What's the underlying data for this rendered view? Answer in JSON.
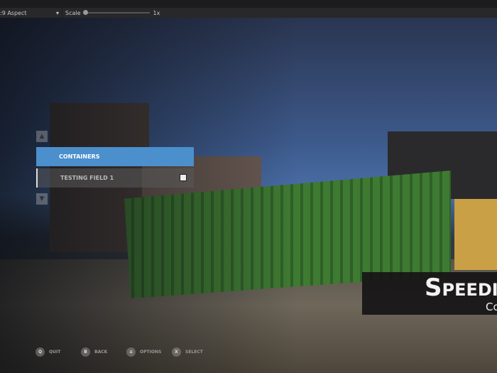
{
  "toolbar": {
    "aspect": ":9 Aspect",
    "scale_label": "Scale",
    "scale_value": "1x"
  },
  "menu": {
    "items": [
      {
        "label": "CONTAINERS",
        "selected": true
      },
      {
        "label": "TESTING FIELD 1",
        "selected": false
      }
    ]
  },
  "footer": [
    {
      "icon": "Q",
      "label": "QUIT"
    },
    {
      "icon": "B",
      "label": "BACK"
    },
    {
      "icon": "≡",
      "label": "OPTIONS"
    },
    {
      "icon": "X",
      "label": "SELECT"
    }
  ],
  "title": {
    "main": "Speedi",
    "sub": "Co"
  },
  "colors": {
    "accent": "#4b8fcd"
  }
}
